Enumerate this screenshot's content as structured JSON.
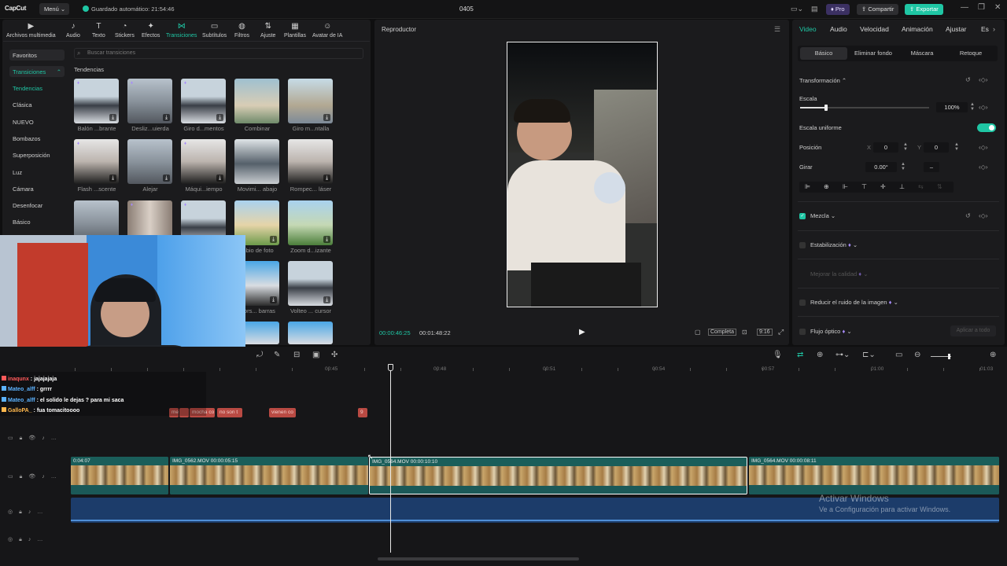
{
  "topbar": {
    "logo": "CapCut",
    "menu": "Menú",
    "autosave": "Guardado automático: 21:54:46",
    "title": "0405",
    "pro": "Pro",
    "share": "Compartir",
    "export": "Exportar"
  },
  "toolbar": [
    {
      "label": "Archivos multimedia",
      "icon": "media-icon"
    },
    {
      "label": "Audio",
      "icon": "audio-icon"
    },
    {
      "label": "Texto",
      "icon": "text-icon"
    },
    {
      "label": "Stickers",
      "icon": "sticker-icon"
    },
    {
      "label": "Efectos",
      "icon": "effects-icon"
    },
    {
      "label": "Transiciones",
      "icon": "transitions-icon",
      "active": true
    },
    {
      "label": "Subtítulos",
      "icon": "subtitles-icon"
    },
    {
      "label": "Filtros",
      "icon": "filters-icon"
    },
    {
      "label": "Ajuste",
      "icon": "adjust-icon"
    },
    {
      "label": "Plantillas",
      "icon": "templates-icon"
    },
    {
      "label": "Avatar de IA",
      "icon": "avatar-icon"
    }
  ],
  "sidebar": {
    "favorites": "Favoritos",
    "section": "Transiciones",
    "items": [
      "Tendencias",
      "Clásica",
      "NUEVO",
      "Bombazos",
      "Superposición",
      "Luz",
      "Cámara",
      "Desenfocar",
      "Básico"
    ]
  },
  "search": {
    "placeholder": "Buscar transiciones"
  },
  "gallery": {
    "heading": "Tendencias",
    "items": [
      "Balón ...brante",
      "Desliz...uierda",
      "Giro d...mentos",
      "Combinar",
      "Giro m...ntalla",
      "Flash ...scente",
      "Alejar",
      "Máqui...iempo",
      "Movimi... abajo",
      "Rompec... láser",
      "",
      "",
      "",
      "mbio de foto",
      "Zoom d...izante",
      "ctors... barras",
      "Volteo ... cursor"
    ]
  },
  "player": {
    "title": "Reproductor",
    "current_time": "00:00:46:25",
    "total_time": "00:01:48:22",
    "ratio_mode": "Completa",
    "aspect": "9:16"
  },
  "right_panel": {
    "tabs": [
      "Video",
      "Audio",
      "Velocidad",
      "Animación",
      "Ajustar",
      "Es"
    ],
    "subtabs": [
      "Básico",
      "Eliminar fondo",
      "Máscara",
      "Retoque"
    ],
    "transform": "Transformación",
    "scale_label": "Escala",
    "scale_value": "100%",
    "scale_fraction": 0.1,
    "uniform_scale": "Escala uniforme",
    "position_label": "Posición",
    "pos_x_label": "X",
    "pos_x": "0",
    "pos_y_label": "Y",
    "pos_y": "0",
    "rotate_label": "Girar",
    "rotate_value": "0.00°",
    "rotate_extra": "–",
    "blend": "Mezcla",
    "stabilize": "Estabilización",
    "improve_quality": "Mejorar la calidad",
    "noise_reduction": "Reducir el ruido de la imagen",
    "optical_flow": "Flujo óptico",
    "apply_all": "Aplicar a todo"
  },
  "timeline": {
    "ruler": [
      "00:45",
      "00:48",
      "00:51",
      "00:54",
      "00:57",
      "01:00",
      "01:03"
    ],
    "subtitle_clips": [
      "me",
      "mocha co",
      "no son t",
      "vienen co",
      "9"
    ],
    "clips": [
      {
        "label": "0:04:07"
      },
      {
        "label": "IMG_0562.MOV  00:00:05:15"
      },
      {
        "label": "IMG_0564.MOV  00:00:10:10"
      },
      {
        "label": "IMG_0564.MOV  00:00:08:11"
      }
    ]
  },
  "chat": [
    {
      "user": "inaqunx",
      "msg": " : jajajajaja",
      "color": "#ff5a5a"
    },
    {
      "user": "Mateo_alff",
      "msg": " : grrrr",
      "color": "#5cb3ff"
    },
    {
      "user": "Mateo_alff",
      "msg": " : el solido le dejas ? para mi saca",
      "color": "#5cb3ff"
    },
    {
      "user": "GalloPA_",
      "msg": " : fua tomacitoooo",
      "color": "#ffb84d"
    }
  ],
  "watermark": {
    "title": "Activar Windows",
    "subtitle": "Ve a Configuración para activar Windows."
  },
  "colors": {
    "accent": "#1fc6a4",
    "pro": "#6b4bff"
  }
}
